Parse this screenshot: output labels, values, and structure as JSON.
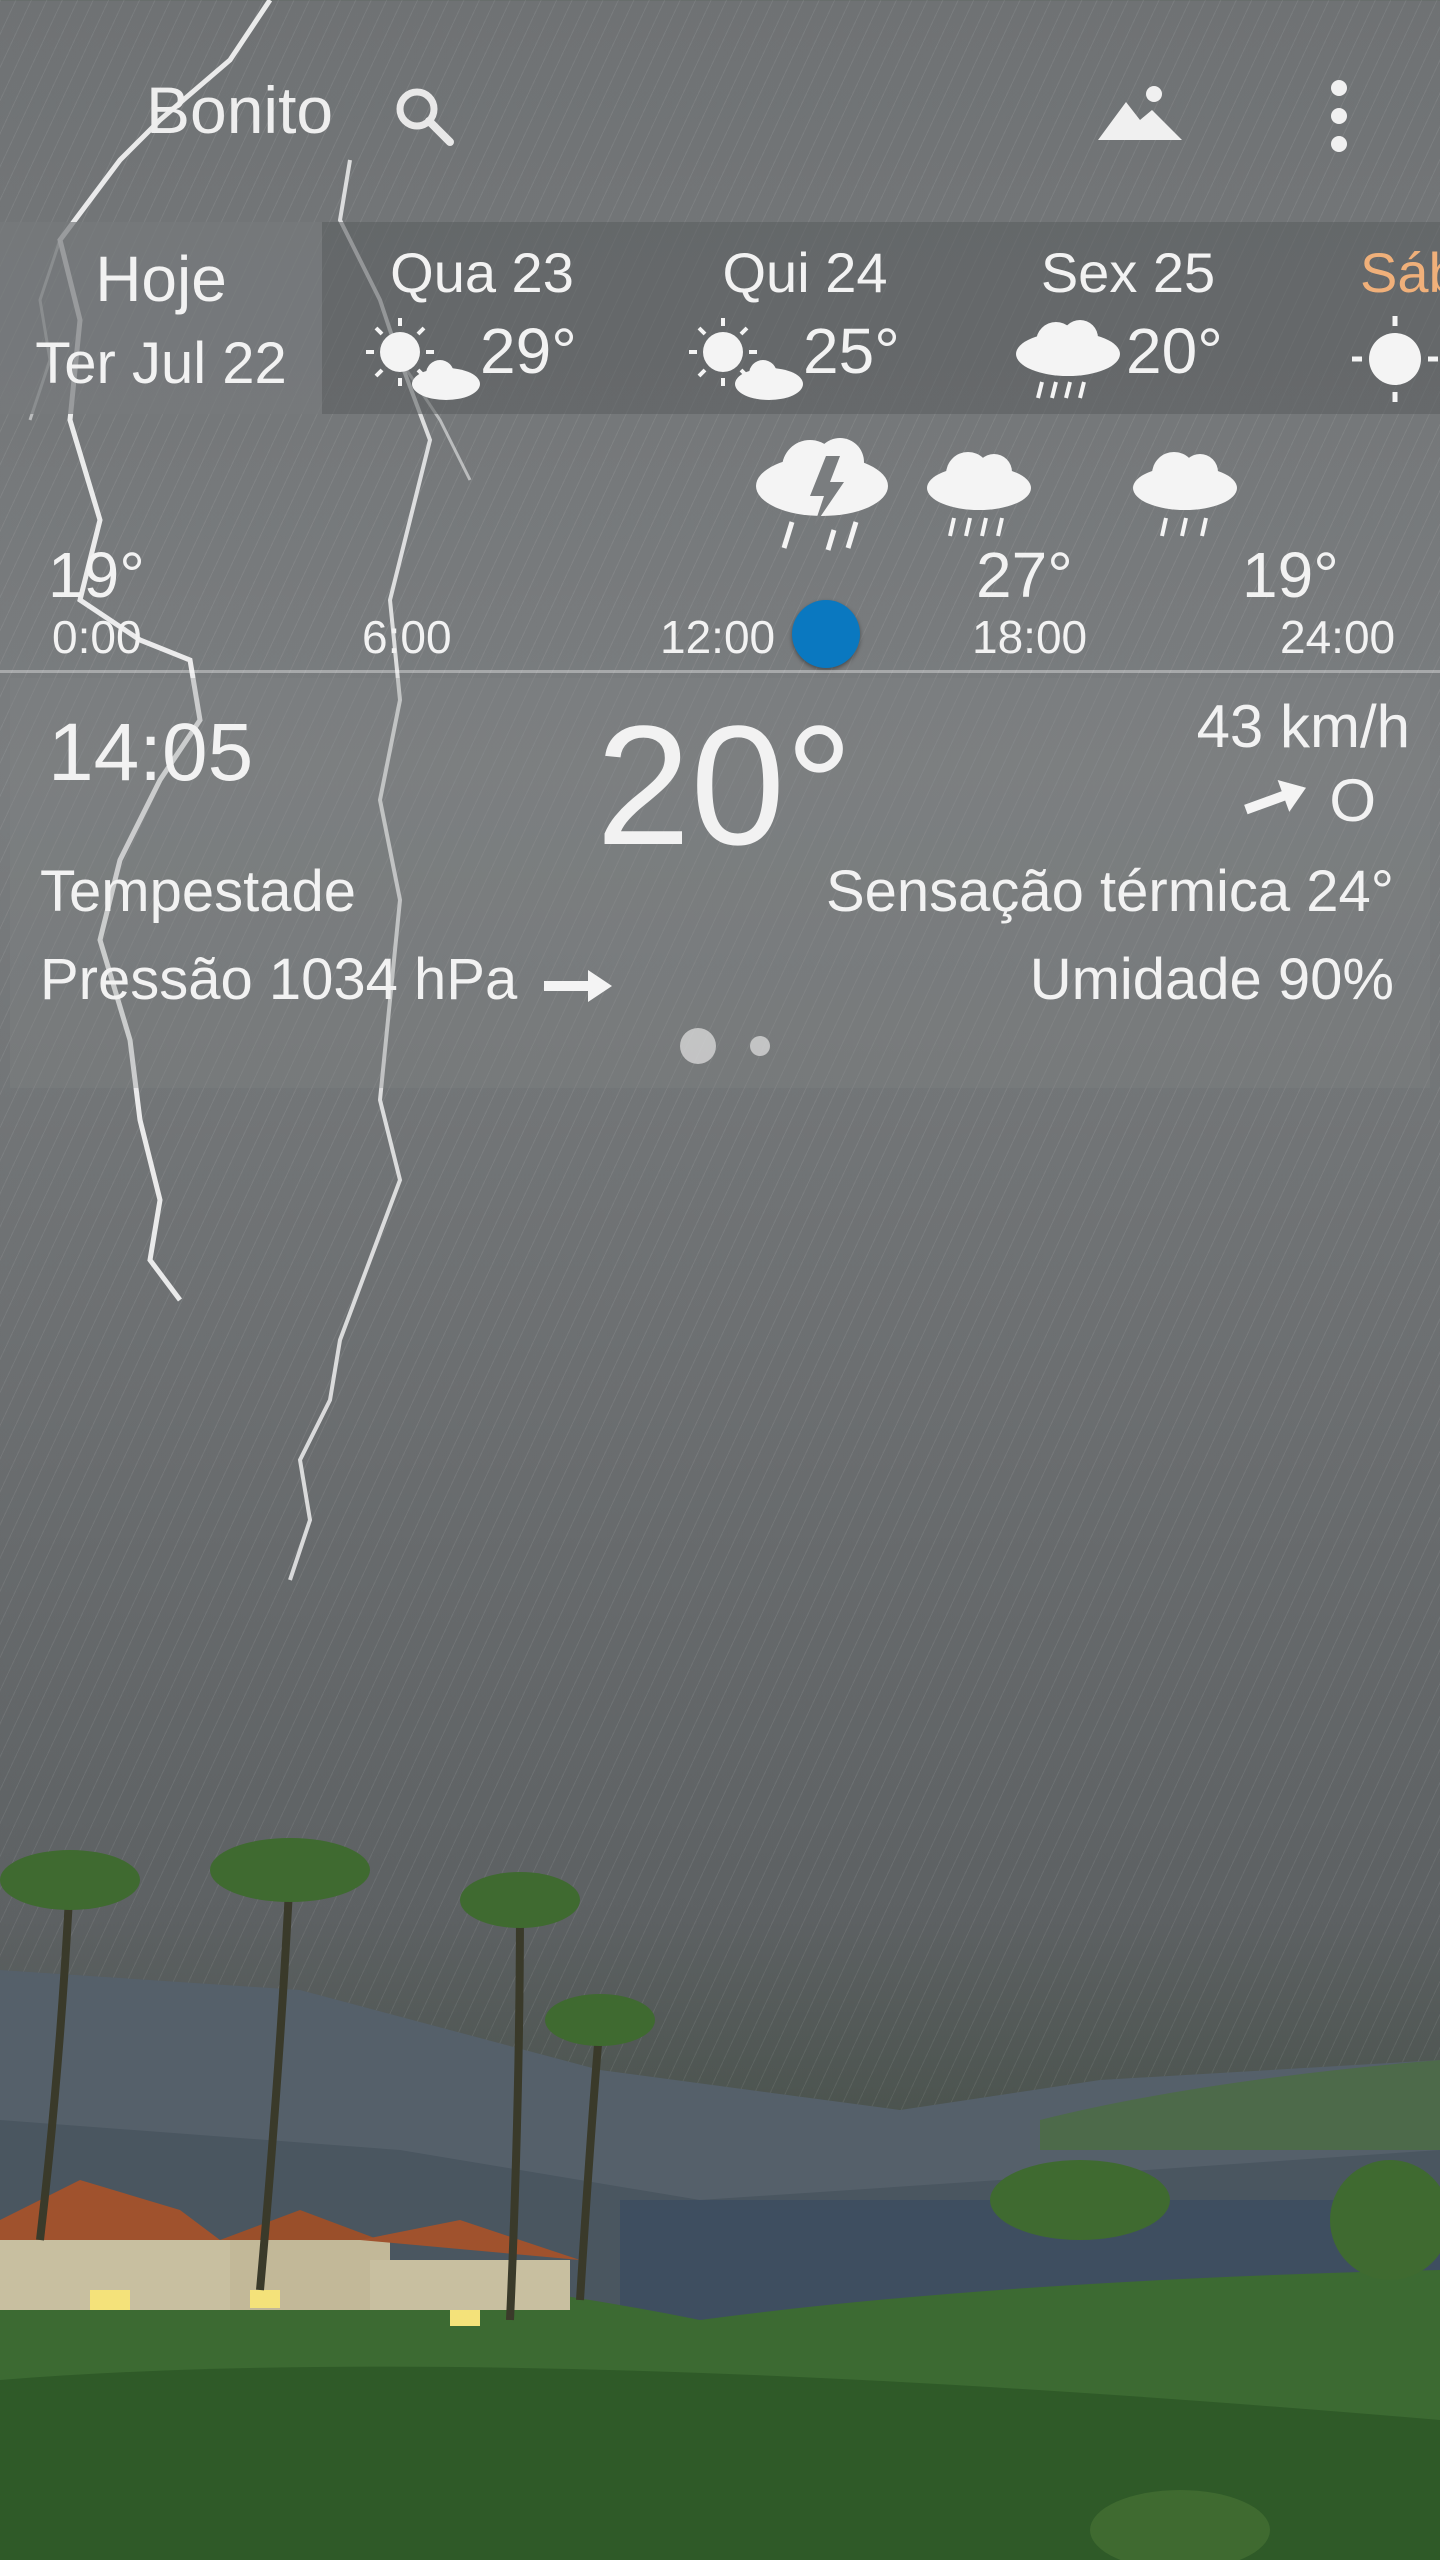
{
  "header": {
    "city": "Bonito"
  },
  "forecast": {
    "today": {
      "label": "Hoje",
      "date": "Ter Jul 22"
    },
    "days": [
      {
        "name": "Qua 23",
        "temp": "29°",
        "icon": "sun-cloud-icon"
      },
      {
        "name": "Qui 24",
        "temp": "25°",
        "icon": "sun-cloud-icon"
      },
      {
        "name": "Sex 25",
        "temp": "20°",
        "icon": "rain-cloud-icon"
      },
      {
        "name": "Sáb",
        "temp": "",
        "icon": "sun-icon"
      }
    ]
  },
  "hourly": {
    "temps": [
      "19°",
      "27°",
      "19°"
    ],
    "labels": [
      "0:00",
      "6:00",
      "12:00",
      "18:00",
      "24:00"
    ],
    "icons": [
      "thunderstorm-icon",
      "rain-cloud-icon",
      "light-rain-cloud-icon"
    ]
  },
  "current": {
    "time": "14:05",
    "temp": "20°",
    "wind_speed": "43 km/h",
    "wind_dir": "O",
    "condition": "Tempestade",
    "feels_like": "Sensação térmica 24°",
    "pressure": "Pressão 1034 hPa",
    "humidity": "Umidade 90%"
  },
  "pager": {
    "pages": 2,
    "active": 1
  },
  "colors": {
    "accent_dot": "#0a78c0",
    "saturday": "#f0b07a"
  }
}
